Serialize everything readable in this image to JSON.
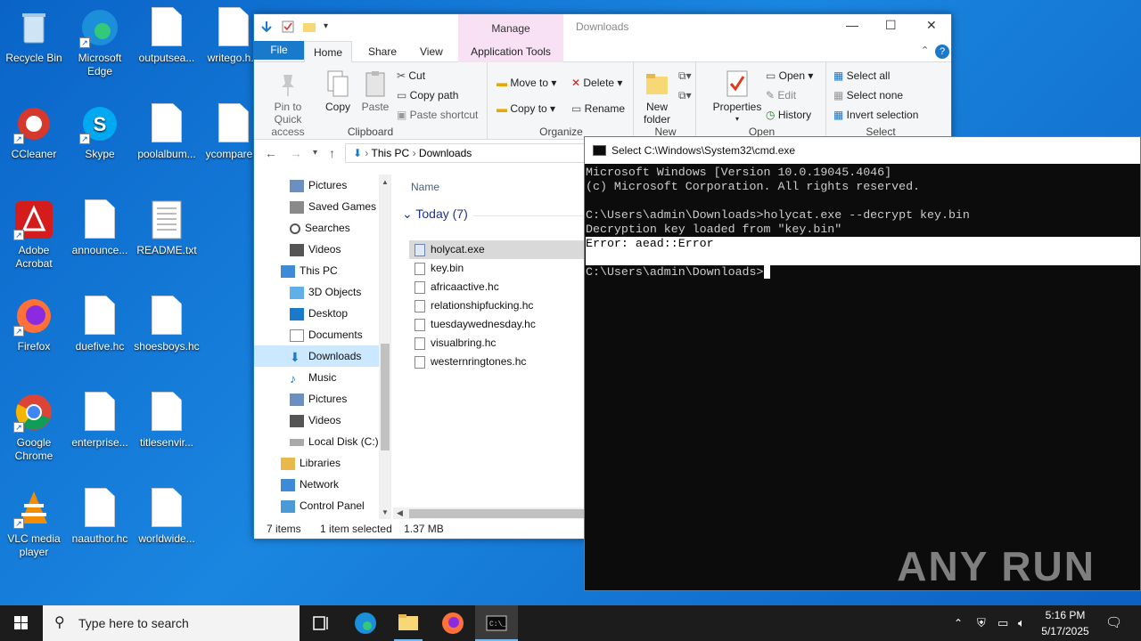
{
  "desktop": {
    "icons": [
      {
        "label": "Recycle Bin"
      },
      {
        "label": "Microsoft Edge"
      },
      {
        "label": "outputsea..."
      },
      {
        "label": "writego.h..."
      },
      {
        "label": "CCleaner"
      },
      {
        "label": "Skype"
      },
      {
        "label": "poolalbum..."
      },
      {
        "label": "ycompare..."
      },
      {
        "label": "Adobe Acrobat"
      },
      {
        "label": "announce..."
      },
      {
        "label": "README.txt"
      },
      {
        "label": "Firefox"
      },
      {
        "label": "duefive.hc"
      },
      {
        "label": "shoesboys.hc"
      },
      {
        "label": "Google Chrome"
      },
      {
        "label": "enterprise..."
      },
      {
        "label": "titlesenvir..."
      },
      {
        "label": "VLC media player"
      },
      {
        "label": "naauthor.hc"
      },
      {
        "label": "worldwide..."
      }
    ]
  },
  "explorer": {
    "title": "Downloads",
    "manage_tab": "Manage",
    "tabs": [
      "File",
      "Home",
      "Share",
      "View",
      "Application Tools"
    ],
    "ribbon": {
      "clipboard": {
        "label": "Clipboard",
        "pin": "Pin to Quick access",
        "copy": "Copy",
        "paste": "Paste",
        "cut": "Cut",
        "copy_path": "Copy path",
        "paste_shortcut": "Paste shortcut"
      },
      "organize": {
        "label": "Organize",
        "move_to": "Move to",
        "copy_to": "Copy to",
        "delete": "Delete",
        "rename": "Rename"
      },
      "new": {
        "label": "New",
        "new_folder": "New folder"
      },
      "open": {
        "label": "Open",
        "properties": "Properties",
        "open": "Open",
        "edit": "Edit",
        "history": "History"
      },
      "select": {
        "label": "Select",
        "select_all": "Select all",
        "select_none": "Select none",
        "invert": "Invert selection"
      }
    },
    "address": {
      "crumbs": [
        "This PC",
        "Downloads"
      ]
    },
    "nav_items": [
      {
        "label": "Pictures"
      },
      {
        "label": "Saved Games"
      },
      {
        "label": "Searches"
      },
      {
        "label": "Videos"
      },
      {
        "label": "This PC"
      },
      {
        "label": "3D Objects"
      },
      {
        "label": "Desktop"
      },
      {
        "label": "Documents"
      },
      {
        "label": "Downloads"
      },
      {
        "label": "Music"
      },
      {
        "label": "Pictures"
      },
      {
        "label": "Videos"
      },
      {
        "label": "Local Disk (C:)"
      },
      {
        "label": "Libraries"
      },
      {
        "label": "Network"
      },
      {
        "label": "Control Panel"
      }
    ],
    "column_name": "Name",
    "group_label": "Today (7)",
    "files": [
      {
        "name": "holycat.exe"
      },
      {
        "name": "key.bin"
      },
      {
        "name": "africaactive.hc"
      },
      {
        "name": "relationshipfucking.hc"
      },
      {
        "name": "tuesdaywednesday.hc"
      },
      {
        "name": "visualbring.hc"
      },
      {
        "name": "westernringtones.hc"
      }
    ],
    "status": {
      "count": "7 items",
      "selected": "1 item selected",
      "size": "1.37 MB"
    }
  },
  "cmd": {
    "title": "Select C:\\Windows\\System32\\cmd.exe",
    "lines": [
      "Microsoft Windows [Version 10.0.19045.4046]",
      "(c) Microsoft Corporation. All rights reserved.",
      "",
      "C:\\Users\\admin\\Downloads>holycat.exe --decrypt key.bin",
      "Decryption key loaded from \"key.bin\"",
      "Error: aead::Error",
      "",
      "C:\\Users\\admin\\Downloads>"
    ],
    "watermark": "ANY RUN"
  },
  "taskbar": {
    "search_placeholder": "Type here to search",
    "time": "5:16 PM",
    "date": "5/17/2025"
  }
}
